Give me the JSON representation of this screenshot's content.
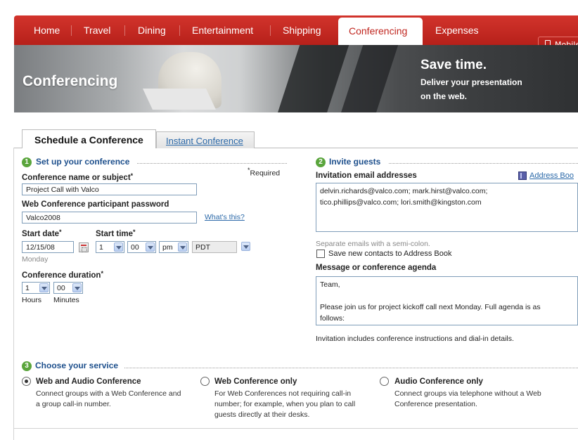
{
  "nav": {
    "items": [
      "Home",
      "Travel",
      "Dining",
      "Entertainment",
      "Shipping",
      "Conferencing",
      "Expenses"
    ],
    "active": "Conferencing",
    "mobile_label": "Mobile"
  },
  "banner": {
    "title": "Conferencing",
    "headline": "Save time.",
    "subline_1": "Deliver your presentation",
    "subline_2": "on the web."
  },
  "tabs": {
    "active": "Schedule a Conference",
    "inactive": "Instant Conference"
  },
  "setup": {
    "step": "1",
    "title": "Set up your conference",
    "required_note": "Required",
    "name_label": "Conference name or subject",
    "name_value": "Project Call with Valco",
    "password_label": "Web Conference participant password",
    "password_value": "Valco2008",
    "whats_this": "What's this?",
    "start_date_label": "Start date",
    "start_date_value": "12/15/08",
    "day_name": "Monday",
    "start_time_label": "Start time",
    "hour": "1",
    "minute": "00",
    "ampm": "pm",
    "timezone": "PDT",
    "duration_label": "Conference duration",
    "duration_hours": "1",
    "duration_minutes": "00",
    "hours_label": "Hours",
    "minutes_label": "Minutes"
  },
  "invite": {
    "step": "2",
    "title": "Invite guests",
    "emails_label": "Invitation email addresses",
    "address_book": "Address Boo",
    "emails_line1": "delvin.richards@valco.com; mark.hirst@valco.com;",
    "emails_line2": "tico.phillips@valco.com; lori.smith@kingston.com",
    "separator_hint": "Separate emails with a semi-colon.",
    "save_contacts": "Save new contacts to Address Book",
    "message_label": "Message or conference agenda",
    "message_line1": "Team,",
    "message_line3": "Please join us for project kickoff call next Monday. Full agenda is as",
    "message_line4": "follows:",
    "includes_note": "Invitation includes conference instructions and dial-in details."
  },
  "service": {
    "step": "3",
    "title": "Choose your service",
    "options": [
      {
        "label": "Web and Audio Conference",
        "selected": true,
        "desc1": "Connect groups with a Web Conference and",
        "desc2": "a group call-in number.",
        "desc3": ""
      },
      {
        "label": "Web Conference only",
        "selected": false,
        "desc1": "For Web Conferences not requiring call-in",
        "desc2": "number; for example, when you plan to call",
        "desc3": "guests directly at their desks."
      },
      {
        "label": "Audio Conference only",
        "selected": false,
        "desc1": "Connect groups via telephone without a Web",
        "desc2": "Conference presentation.",
        "desc3": ""
      }
    ]
  },
  "colors": {
    "nav_red": "#c0261f",
    "step_green": "#5aa53c",
    "section_blue": "#1d4f8c",
    "link_blue": "#2a68a8"
  }
}
